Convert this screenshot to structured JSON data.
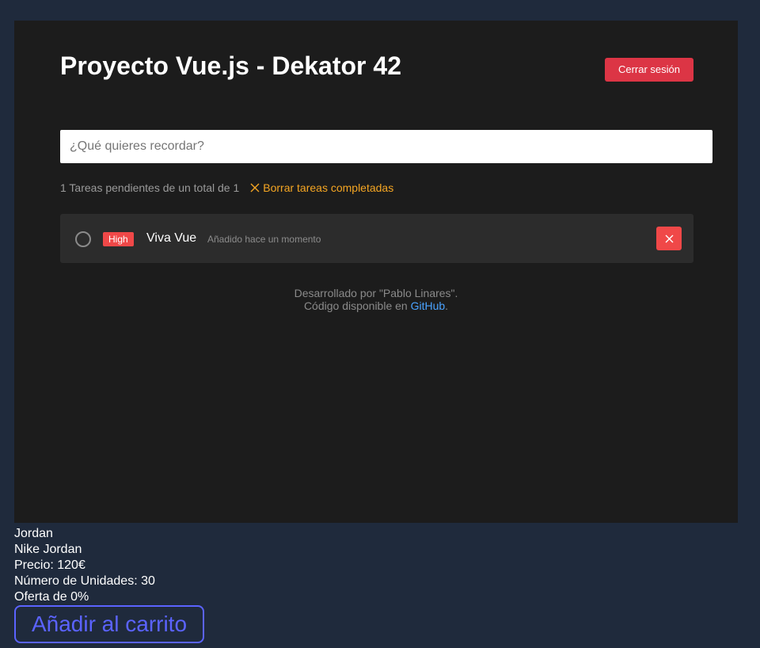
{
  "app": {
    "title": "Proyecto Vue.js - Dekator 42",
    "logout_label": "Cerrar sesión",
    "input_placeholder": "¿Qué quieres recordar?",
    "input_value": ""
  },
  "summary": {
    "pending_text": "1 Tareas pendientes de un total de 1",
    "clear_completed_label": "Borrar tareas completadas"
  },
  "tasks": [
    {
      "priority": "High",
      "name": "Viva Vue",
      "added": "Añadido hace un momento",
      "completed": false
    }
  ],
  "footer": {
    "line1": "Desarrollado por \"Pablo Linares\".",
    "line2_prefix": "Código disponible en ",
    "link_text": "GitHub",
    "line2_suffix": "."
  },
  "product": {
    "name": "Jordan",
    "full_name": "Nike Jordan",
    "price": "Precio: 120€",
    "units": "Número de Unidades: 30",
    "offer": "Oferta de 0%",
    "add_to_cart_label": "Añadir al carrito"
  },
  "colors": {
    "page_background": "#1f2a3c",
    "panel_background": "#1c1c1c",
    "danger": "#dc3545",
    "priority_high": "#f04848",
    "clear_link": "#f5a623",
    "link": "#4aa3ff",
    "cart_button": "#5b63ff"
  },
  "icons": {
    "clear": "close-icon",
    "delete": "close-icon",
    "checkbox": "circle-outline-icon"
  }
}
